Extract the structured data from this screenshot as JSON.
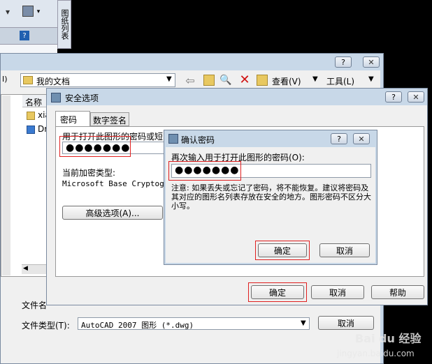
{
  "sidebar_vertical_label": "图纸列表",
  "file_dialog": {
    "lookin_value": "我的文档",
    "toolbar_view": "查看(V)",
    "toolbar_tools": "工具(L)",
    "col_name": "名称",
    "items": [
      "xia",
      "Dr"
    ],
    "filename_label": "文件名",
    "filetype_label": "文件类型(T):",
    "filetype_value": "AutoCAD 2007 图形 (*.dwg)",
    "cancel_label": "取消",
    "left_edge_label": "I)"
  },
  "security_dialog": {
    "title": "安全选项",
    "tabs": [
      "密码",
      "数字签名"
    ],
    "password_prompt": "用于打开此图形的密码或短",
    "password_value": "●●●●●●●",
    "encryption_label": "当前加密类型:",
    "encryption_value": "Microsoft Base Cryptogra",
    "advanced_button": "高级选项(A)...",
    "ok_label": "确定",
    "cancel_label": "取消",
    "help_label": "帮助"
  },
  "confirm_dialog": {
    "title": "确认密码",
    "prompt": "再次输入用于打开此图形的密码(O):",
    "password_value": "●●●●●●●",
    "note": "注意: 如果丢失或忘记了密码，将不能恢复。建议将密码及其对应的图形名列表存放在安全的地方。图形密码不区分大小写。",
    "ok_label": "确定",
    "cancel_label": "取消"
  },
  "watermark": {
    "brand": "Bai du 经验",
    "url": "jingyan.baidu.com"
  },
  "colors": {
    "highlight_red": "#e02020",
    "title_bar": "#c8d8e8"
  }
}
